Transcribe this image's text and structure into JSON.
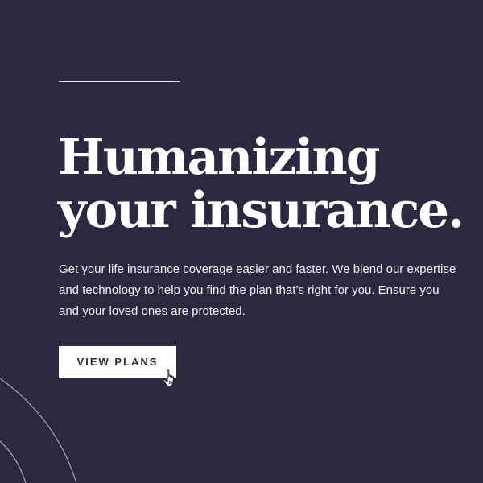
{
  "hero": {
    "headline_line1": "Humanizing",
    "headline_line2": "your insurance.",
    "body_line1": "Get your life insurance coverage easier and faster. We blend our expertise",
    "body_line2": "and technology to help you find the plan that’s right for you. Ensure you",
    "body_line3": "and your loved ones are protected.",
    "cta_label": "VIEW PLANS"
  },
  "colors": {
    "background": "#2d283f",
    "text": "#ffffff",
    "button_bg": "#ffffff",
    "button_text": "#2d283f"
  },
  "icons": {
    "cursor": "hand-pointer-icon"
  }
}
